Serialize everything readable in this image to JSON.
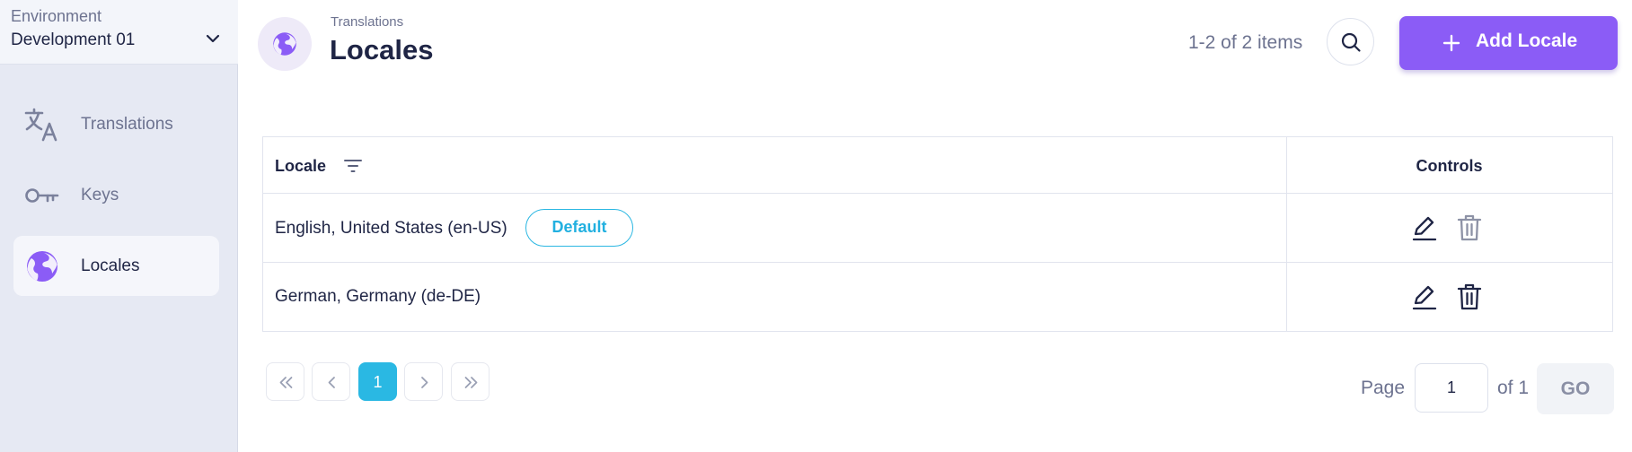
{
  "sidebar": {
    "environment_label": "Environment",
    "environment_value": "Development 01",
    "items": [
      {
        "label": "Translations",
        "icon": "translate-icon",
        "active": false
      },
      {
        "label": "Keys",
        "icon": "key-icon",
        "active": false
      },
      {
        "label": "Locales",
        "icon": "globe-icon",
        "active": true
      }
    ]
  },
  "header": {
    "icon": "globe-icon",
    "breadcrumb": "Translations",
    "title": "Locales",
    "items_count": "1-2 of 2 items",
    "search_icon": "search-icon",
    "add_button_label": "Add Locale"
  },
  "table": {
    "columns": [
      "Locale",
      "Controls"
    ],
    "rows": [
      {
        "locale": "English, United States (en-US)",
        "badge": "Default",
        "delete_enabled": false
      },
      {
        "locale": "German, Germany (de-DE)",
        "badge": null,
        "delete_enabled": true
      }
    ]
  },
  "pagination": {
    "current_page": "1",
    "page_label": "Page",
    "page_input_value": "1",
    "of_label": "of 1",
    "go_label": "GO"
  },
  "colors": {
    "accent_purple": "#8b5cf6",
    "accent_cyan": "#2ab8e3",
    "sidebar_bg": "#e6e9f3",
    "text_dark": "#1f2545",
    "text_muted": "#6d7390"
  }
}
